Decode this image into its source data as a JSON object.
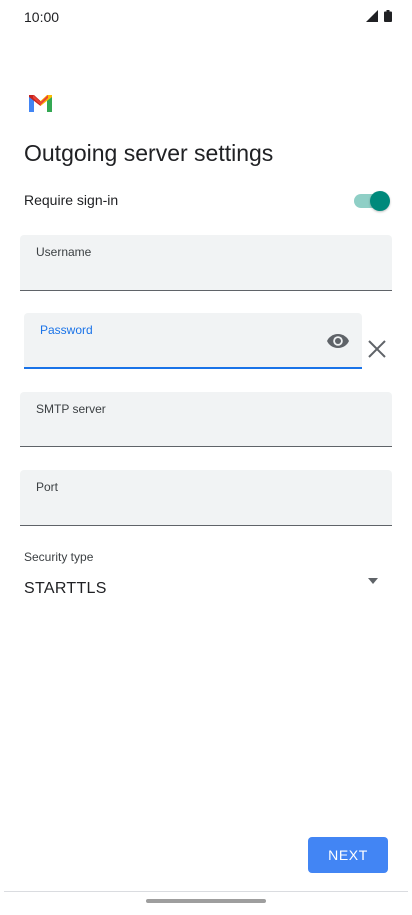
{
  "status_bar": {
    "time": "10:00",
    "icons": [
      "cellular-signal-icon",
      "battery-icon"
    ]
  },
  "app": {
    "logo": "gmail-logo"
  },
  "page": {
    "title": "Outgoing server settings"
  },
  "require_signin": {
    "label": "Require sign-in",
    "enabled": true
  },
  "fields": {
    "username": {
      "label": "Username",
      "value": ""
    },
    "password": {
      "label": "Password",
      "value": "",
      "focused": true
    },
    "smtp_server": {
      "label": "SMTP server",
      "value": ""
    },
    "port": {
      "label": "Port",
      "value": ""
    }
  },
  "security": {
    "label": "Security type",
    "value": "STARTTLS"
  },
  "actions": {
    "next_label": "NEXT"
  },
  "colors": {
    "accent": "#1a73e8",
    "toggle_on": "#00897b",
    "button": "#4285f4",
    "field_bg": "#f1f3f4"
  }
}
